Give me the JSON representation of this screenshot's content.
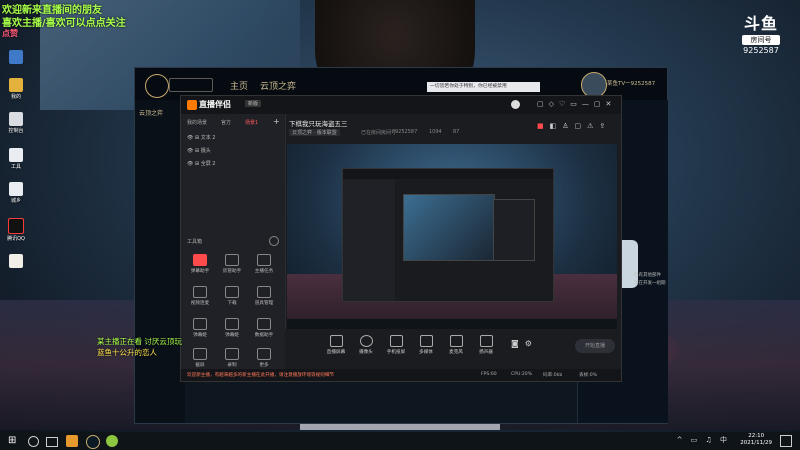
{
  "overlay": {
    "line1": "欢迎新来直播间的朋友",
    "line2": "喜欢主播/喜欢可以点点关注",
    "line3": "点赞"
  },
  "desktop_icons": [
    "",
    "我的",
    "控制台",
    "工具",
    "城乡",
    "腾讯QQ",
    ""
  ],
  "douyu": {
    "logo": "斗鱼",
    "label": "房间号",
    "room": "9252587"
  },
  "lol": {
    "tabs": [
      "主页",
      "云顶之弈"
    ],
    "user_name": "某鱼TV一9252587",
    "side_label": "云顶之弈",
    "notice": "一切皆若你处于特别，你已经被禁用",
    "right_text": [
      "已有其他部件",
      "正在开发一组期"
    ]
  },
  "zb": {
    "title": "直播伴侣",
    "version": "新版",
    "stream_title": "下棋我只玩海盗五三",
    "category": "云顶之弈 · 版本联盟",
    "room_label": "已在房间房间号",
    "room_id": "9252587",
    "viewers": "1094",
    "likes": "87",
    "layer_tabs": [
      "我的场景",
      "官方",
      "场景1"
    ],
    "layers": [
      "文本 2",
      "摄头",
      "全屏 2"
    ],
    "tools_title": "工具箱",
    "tools": [
      "弹幕助手",
      "房管助手",
      "主播任务",
      "视频连麦",
      "下载",
      "道具管理",
      "弹幕姬",
      "弹幕姬",
      "数据助手",
      "截屏",
      "录制",
      "更多"
    ],
    "bottom": [
      "直播屏幕",
      "摄像头",
      "手机投屏",
      "多媒体",
      "麦克风",
      "扬声器"
    ],
    "start_button": "开始直播",
    "status_left": "欢迎新主播，有越来越多的新主播在此开播，请注意播放环境等规则细节",
    "status_right": [
      "FPS:60",
      "CPU:20%",
      "码率:0kb",
      "丢帧:0%"
    ]
  },
  "chat": [
    "某主播正在看 讨厌云顶玩",
    "蓝鱼十公升的恋人"
  ],
  "taskbar": {
    "time": "22:10",
    "date": "2021/11/29"
  }
}
